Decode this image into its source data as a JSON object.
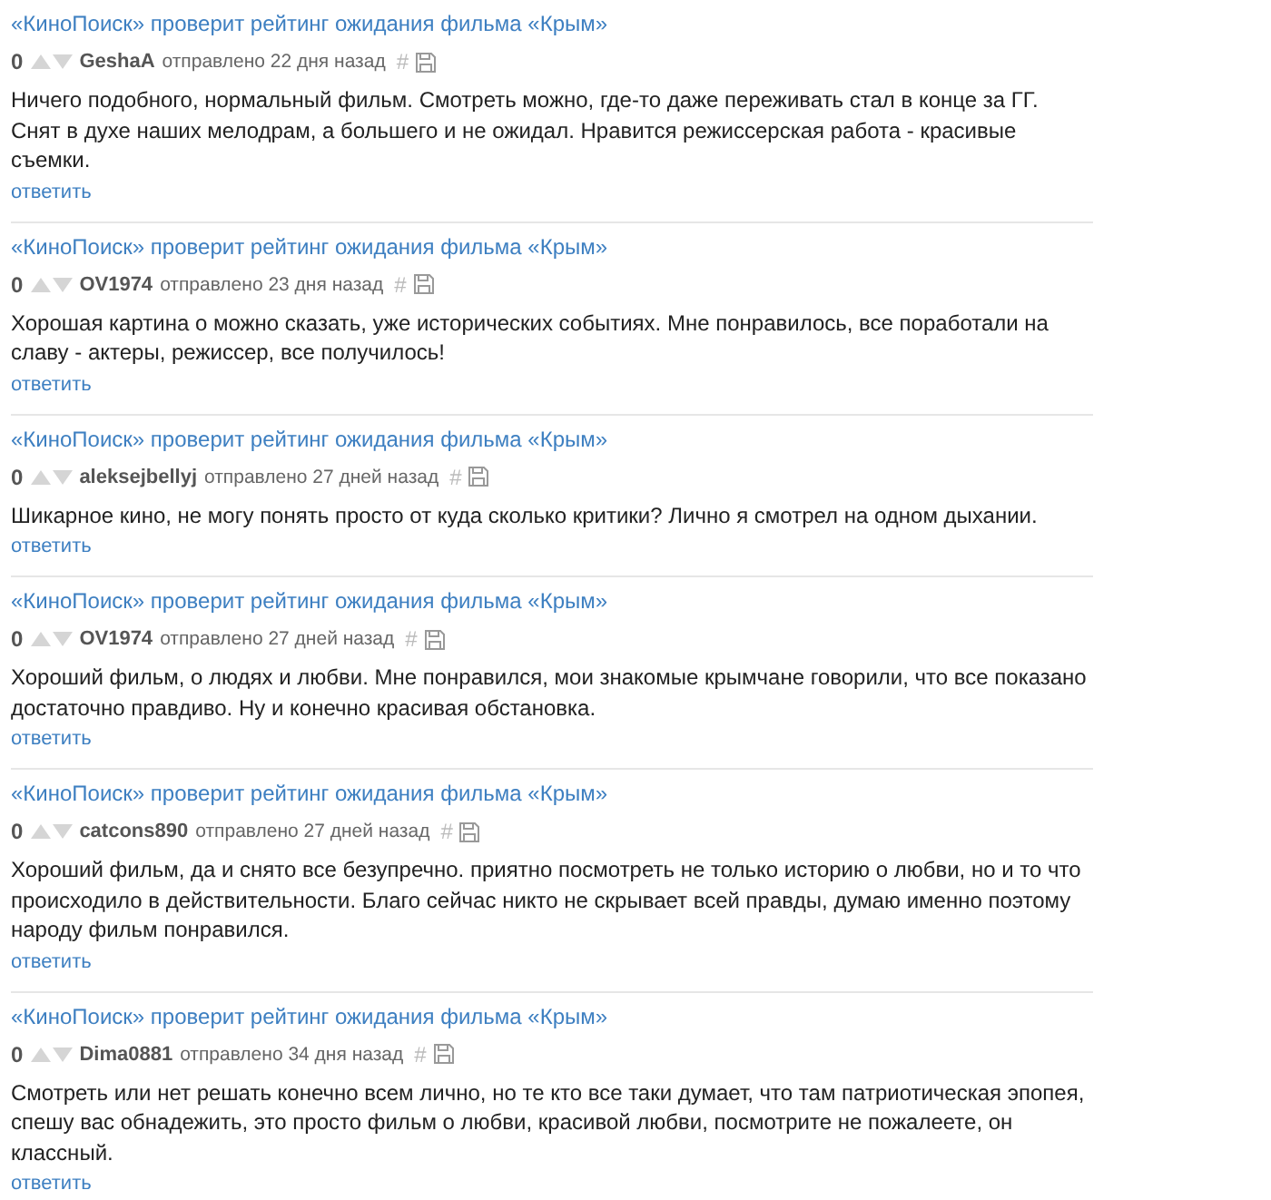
{
  "comments": [
    {
      "article": "«КиноПоиск» проверит рейтинг ожидания фильма «Крым»",
      "score": "0",
      "author": "GeshaA",
      "posted": "отправлено 22 дня назад",
      "hash": "#",
      "text": "Ничего подобного, нормальный фильм. Смотреть можно, где-то даже переживать стал в конце за ГГ. Снят в духе наших мелодрам, а большего и не ожидал. Нравится режиссерская работа - красивые съемки.",
      "reply": "ответить"
    },
    {
      "article": "«КиноПоиск» проверит рейтинг ожидания фильма «Крым»",
      "score": "0",
      "author": "OV1974",
      "posted": "отправлено 23 дня назад",
      "hash": "#",
      "text": "Хорошая картина о можно сказать, уже исторических событиях. Мне понравилось, все поработали на славу - актеры, режиссер, все получилось!",
      "reply": "ответить"
    },
    {
      "article": "«КиноПоиск» проверит рейтинг ожидания фильма «Крым»",
      "score": "0",
      "author": "aleksejbellyj",
      "posted": "отправлено 27 дней назад",
      "hash": "#",
      "text": "Шикарное кино, не могу понять просто от куда сколько критики? Лично я смотрел на одном дыхании.",
      "reply": "ответить"
    },
    {
      "article": "«КиноПоиск» проверит рейтинг ожидания фильма «Крым»",
      "score": "0",
      "author": "OV1974",
      "posted": "отправлено 27 дней назад",
      "hash": "#",
      "text": "Хороший фильм, о людях и любви. Мне понравился, мои знакомые крымчане говорили, что все показано достаточно правдиво. Ну и конечно красивая обстановка.",
      "reply": "ответить"
    },
    {
      "article": "«КиноПоиск» проверит рейтинг ожидания фильма «Крым»",
      "score": "0",
      "author": "catcons890",
      "posted": "отправлено 27 дней назад",
      "hash": "#",
      "text": "Хороший фильм, да и снято все безупречно. приятно посмотреть не только историю о любви, но и то что происходило в действительности. Благо сейчас никто не скрывает всей правды, думаю именно поэтому народу фильм понравился.",
      "reply": "ответить"
    },
    {
      "article": "«КиноПоиск» проверит рейтинг ожидания фильма «Крым»",
      "score": "0",
      "author": "Dima0881",
      "posted": "отправлено 34 дня назад",
      "hash": "#",
      "text": "Смотреть или нет решать конечно всем лично, но те кто все таки думает, что там патриотическая эпопея, спешу вас обнадежить, это просто фильм о любви, красивой любви, посмотрите не пожалеете, он классный.",
      "reply": "ответить"
    }
  ]
}
